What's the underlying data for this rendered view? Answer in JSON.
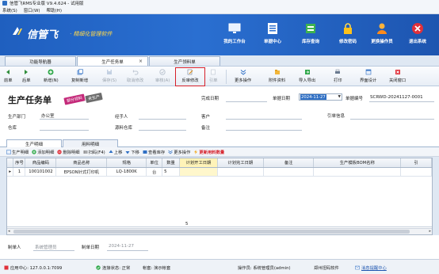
{
  "window": {
    "title": "信管飞RMS专业版 V9.4.624 - 试用版"
  },
  "menubar": {
    "items": [
      "系统(S)",
      "窗口(W)",
      "帮助(H)"
    ]
  },
  "banner": {
    "logo": "信管飞",
    "subtitle": "· 精细化管理软件",
    "buttons": [
      {
        "label": "我的工作台",
        "icon": "monitor-icon"
      },
      {
        "label": "单据中心",
        "icon": "document-list-icon"
      },
      {
        "label": "库存查询",
        "icon": "warehouse-icon"
      },
      {
        "label": "修改密码",
        "icon": "lock-icon"
      },
      {
        "label": "更换操作员",
        "icon": "user-icon"
      },
      {
        "label": "退出系统",
        "icon": "exit-icon"
      }
    ]
  },
  "tabs": [
    {
      "label": "功能导航器",
      "active": false
    },
    {
      "label": "生产任务单",
      "active": true,
      "close": "×"
    },
    {
      "label": "生产领料单",
      "active": false
    }
  ],
  "toolbar": {
    "buttons": [
      {
        "label": "前单",
        "icon": "arrow-left-icon",
        "disabled": false
      },
      {
        "label": "后单",
        "icon": "arrow-right-icon",
        "disabled": false
      },
      {
        "label": "新增(N)",
        "icon": "add-icon",
        "disabled": false,
        "dropdown": true
      },
      {
        "label": "复制新增",
        "icon": "copy-icon",
        "disabled": false
      },
      {
        "label": "保存(S)",
        "icon": "save-icon",
        "disabled": true
      },
      {
        "label": "取消修改",
        "icon": "undo-icon",
        "disabled": true
      },
      {
        "label": "审核(A)",
        "icon": "audit-icon",
        "disabled": true
      },
      {
        "label": "反审修改",
        "icon": "edit-icon",
        "disabled": false,
        "highlighted": true
      },
      {
        "label": "引单",
        "icon": "import-doc-icon",
        "disabled": true,
        "dropdown": true
      },
      {
        "label": "更多操作",
        "icon": "more-icon",
        "disabled": false,
        "dropdown": true
      },
      {
        "label": "附件资料",
        "icon": "attachment-icon",
        "disabled": false
      },
      {
        "label": "导入导出",
        "icon": "import-export-icon",
        "disabled": false,
        "dropdown": true
      },
      {
        "label": "打印",
        "icon": "print-icon",
        "disabled": false,
        "dropdown": true
      },
      {
        "label": "界面设计",
        "icon": "design-icon",
        "disabled": false
      },
      {
        "label": "关闭窗口",
        "icon": "close-window-icon",
        "disabled": false
      }
    ],
    "highlight_color": "#d6202a"
  },
  "form": {
    "title": "生产任务单",
    "stamp_pink": "部分领料",
    "stamp_gray": "未生产",
    "complete_date_label": "完成日期",
    "doc_date_label": "单据日期",
    "doc_date_value": "2024-11-27",
    "doc_no_label": "单据编号",
    "doc_no_value": "SCRWD-20241127-0001",
    "dept_label": "生产部门",
    "dept_value": "办公室",
    "handler_label": "经手人",
    "customer_label": "客户",
    "ref_label": "引单信息",
    "warehouse_label": "仓库",
    "source_wh_label": "源料仓库",
    "remark_label": "备注"
  },
  "subtabs": [
    {
      "label": "生产明细",
      "active": true
    },
    {
      "label": "用料明细",
      "active": false
    }
  ],
  "grid_toolbar": [
    {
      "label": "生产明细",
      "icon": "detail-icon",
      "dropdown": true
    },
    {
      "label": "添加明细",
      "icon": "add-row-icon"
    },
    {
      "label": "删除明细",
      "icon": "delete-row-icon"
    },
    {
      "label": "扫码(F4)",
      "icon": "scan-icon"
    },
    {
      "label": "上移",
      "icon": "move-up-icon"
    },
    {
      "label": "下移",
      "icon": "move-down-icon"
    },
    {
      "label": "查看库存",
      "icon": "stock-icon"
    },
    {
      "label": "更多操作",
      "icon": "more-icon",
      "dropdown": true
    },
    {
      "label": "更新用料数量",
      "icon": "lightning-icon",
      "dropdown": true,
      "emphasis": true
    }
  ],
  "grid": {
    "columns": [
      "序号",
      "商品编码",
      "商品名称",
      "规格",
      "单位",
      "数量",
      "计划开工日期",
      "计划完工日期",
      "备注",
      "生产模板BOM名称",
      "引"
    ],
    "rows": [
      {
        "marker": "▸",
        "cells": [
          "1",
          "100101002",
          "EPSON针式打印机",
          "LQ-1800K",
          "台",
          "5",
          "",
          "",
          "",
          "",
          ""
        ]
      }
    ],
    "total_qty": "5"
  },
  "bottom": {
    "maker_label": "制单人",
    "maker_value": "系统管理员",
    "make_date_label": "制单日期",
    "make_date_value": "2024-11-27"
  },
  "statusbar": {
    "app_center": "应用中心: 127.0.0.1:7099",
    "connection": "连接状态: 正常",
    "account": "帐套: 演示帐套",
    "operator": "操作员: 系统管理员(admin)",
    "vendor": "郑州扭码软件",
    "feedback": "消息提醒中心"
  }
}
